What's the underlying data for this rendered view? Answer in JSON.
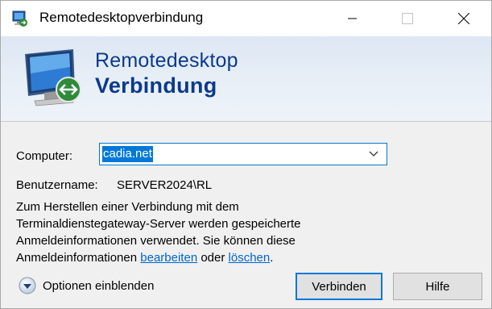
{
  "window": {
    "title": "Remotedesktopverbindung"
  },
  "banner": {
    "line1": "Remotedesktop",
    "line2": "Verbindung"
  },
  "form": {
    "computer_label": "Computer:",
    "computer_value": "cadia.net",
    "username_label": "Benutzername:",
    "username_value": "SERVER2024\\RL",
    "info_part1": "Zum Herstellen einer Verbindung mit dem Terminaldienstegateway-Server werden gespeicherte Anmeldeinformationen verwendet. Sie können diese Anmeldeinformationen ",
    "link_edit": "bearbeiten",
    "info_part2": " oder ",
    "link_delete": "löschen",
    "info_part3": "."
  },
  "footer": {
    "options_label": "Optionen einblenden",
    "connect_label": "Verbinden",
    "help_label": "Hilfe"
  },
  "icons": {
    "app": "remote-desktop-icon",
    "minimize": "minimize-icon",
    "maximize": "maximize-icon",
    "close": "close-icon",
    "dropdown": "chevron-down-icon",
    "options": "expand-circle-icon"
  },
  "colors": {
    "accent": "#0078d7",
    "banner_text": "#0b3a8c",
    "link": "#0066cc"
  }
}
